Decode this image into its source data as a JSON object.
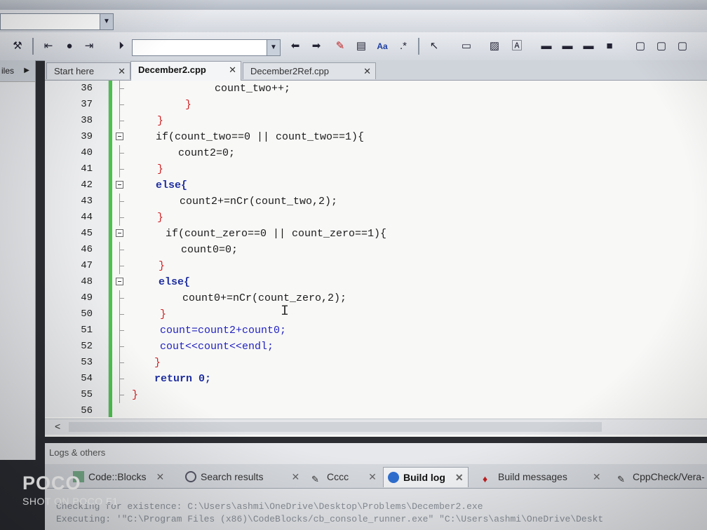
{
  "tabs": [
    {
      "label": "Start here",
      "active": false
    },
    {
      "label": "December2.cpp",
      "active": true
    },
    {
      "label": "December2Ref.cpp",
      "active": false
    }
  ],
  "side_panel": {
    "label": "iles"
  },
  "editor": {
    "lines": [
      {
        "num": "36",
        "code": "count_two++;"
      },
      {
        "num": "37",
        "code": "}"
      },
      {
        "num": "38",
        "code": "}"
      },
      {
        "num": "39",
        "code": "if(count_two==0 || count_two==1){"
      },
      {
        "num": "40",
        "code": "count2=0;"
      },
      {
        "num": "41",
        "code": "}"
      },
      {
        "num": "42",
        "code": "else{"
      },
      {
        "num": "43",
        "code": "count2+=nCr(count_two,2);"
      },
      {
        "num": "44",
        "code": "}"
      },
      {
        "num": "45",
        "code": "if(count_zero==0 || count_zero==1){"
      },
      {
        "num": "46",
        "code": "count0=0;"
      },
      {
        "num": "47",
        "code": "}"
      },
      {
        "num": "48",
        "code": "else{"
      },
      {
        "num": "49",
        "code": "count0+=nCr(count_zero,2);"
      },
      {
        "num": "50",
        "code": "}"
      },
      {
        "num": "51",
        "code": "count=count2+count0;"
      },
      {
        "num": "52",
        "code": "cout<<count<<endl;"
      },
      {
        "num": "53",
        "code": "}"
      },
      {
        "num": "54",
        "code": "return 0;"
      },
      {
        "num": "55",
        "code": "}"
      },
      {
        "num": "56",
        "code": ""
      }
    ]
  },
  "logs": {
    "title": "Logs & others",
    "tabs": [
      {
        "label": "Code::Blocks",
        "active": false
      },
      {
        "label": "Search results",
        "active": false
      },
      {
        "label": "Cccc",
        "active": false
      },
      {
        "label": "Build log",
        "active": true
      },
      {
        "label": "Build messages",
        "active": false
      },
      {
        "label": "CppCheck/Vera-",
        "active": false
      }
    ],
    "output": [
      "Checking for existence: C:\\Users\\ashmi\\OneDrive\\Desktop\\Problems\\December2.exe",
      "Executing: '\"C:\\Program Files (x86)\\CodeBlocks/cb_console_runner.exe\" \"C:\\Users\\ashmi\\OneDrive\\Deskt"
    ]
  },
  "watermark": {
    "brand": "POCO",
    "sub": "SHOT ON POCO F1"
  },
  "colors": {
    "change_bar": "#4bc34b",
    "keyword": "#1f2fa0",
    "operator": "#d02020",
    "number": "#d060e0"
  },
  "toolbar_icons": [
    "cut-icon",
    "copy-icon",
    "paste-icon",
    "find-icon",
    "replace-icon",
    "wrench-icon",
    "jump-back-icon",
    "bookmark-icon",
    "jump-forward-icon",
    "run-icon",
    "prev-icon",
    "next-icon",
    "highlight-icon",
    "format-icon",
    "match-case-icon",
    "regex-icon",
    "select-icon"
  ]
}
